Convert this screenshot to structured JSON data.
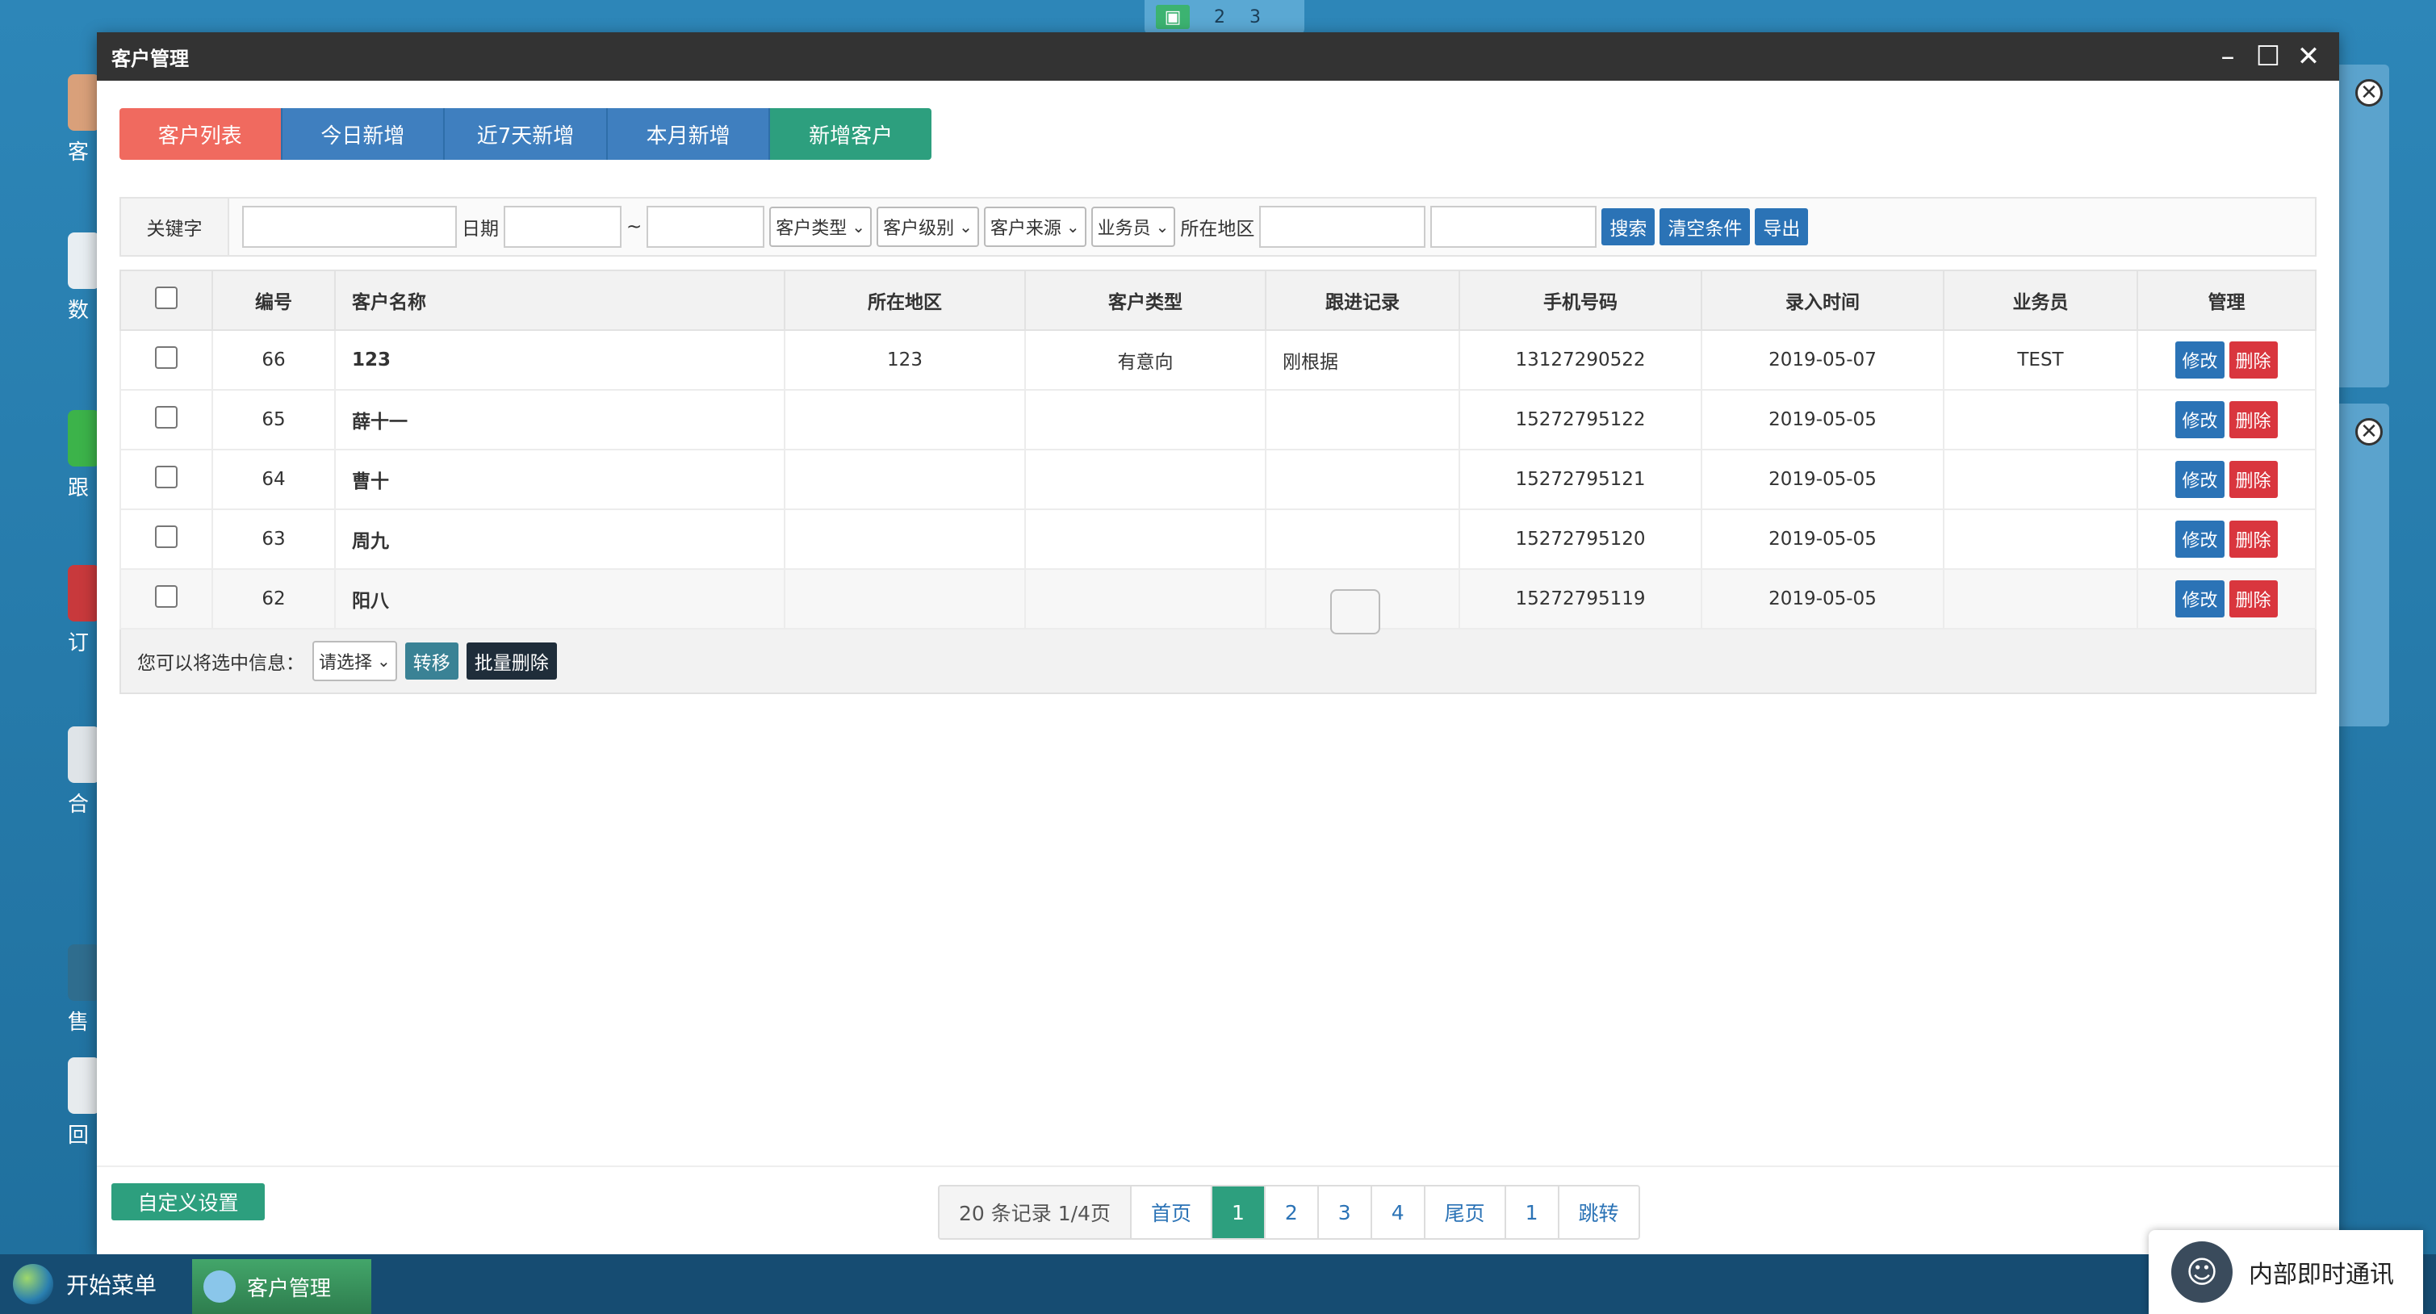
{
  "workspace": {
    "items": [
      "2",
      "3"
    ]
  },
  "desktop": {
    "icons": [
      "客",
      "数",
      "跟",
      "订",
      "合",
      "售",
      "回"
    ]
  },
  "window": {
    "title": "客户管理"
  },
  "tabs": [
    "客户列表",
    "今日新增",
    "近7天新增",
    "本月新增",
    "新增客户"
  ],
  "search": {
    "keyword_label": "关键字",
    "date_label": "日期",
    "tilde": "~",
    "selects": [
      "客户类型",
      "客户级别",
      "客户来源",
      "业务员"
    ],
    "region_label": "所在地区",
    "buttons": [
      "搜索",
      "清空条件",
      "导出"
    ]
  },
  "table": {
    "headers": [
      "编号",
      "客户名称",
      "所在地区",
      "客户类型",
      "跟进记录",
      "手机号码",
      "录入时间",
      "业务员",
      "管理"
    ],
    "rows": [
      {
        "id": "66",
        "name": "123",
        "region": "123",
        "type": "有意向",
        "follow": "刚根据",
        "phone": "13127290522",
        "date": "2019-05-07",
        "sales": "TEST"
      },
      {
        "id": "65",
        "name": "薛十一",
        "region": "",
        "type": "",
        "follow": "",
        "phone": "15272795122",
        "date": "2019-05-05",
        "sales": ""
      },
      {
        "id": "64",
        "name": "曹十",
        "region": "",
        "type": "",
        "follow": "",
        "phone": "15272795121",
        "date": "2019-05-05",
        "sales": ""
      },
      {
        "id": "63",
        "name": "周九",
        "region": "",
        "type": "",
        "follow": "",
        "phone": "15272795120",
        "date": "2019-05-05",
        "sales": ""
      },
      {
        "id": "62",
        "name": "阳八",
        "region": "",
        "type": "",
        "follow": "",
        "phone": "15272795119",
        "date": "2019-05-05",
        "sales": ""
      }
    ],
    "edit_label": "修改",
    "delete_label": "删除"
  },
  "batch": {
    "label": "您可以将选中信息：",
    "select": "请选择",
    "transfer": "转移",
    "bulk_delete": "批量删除"
  },
  "footer": {
    "custom_settings": "自定义设置",
    "pager_info": "20 条记录 1/4页",
    "first": "首页",
    "pages": [
      "1",
      "2",
      "3",
      "4"
    ],
    "current_page": "1",
    "last": "尾页",
    "jump_value": "1",
    "jump": "跳转"
  },
  "taskbar": {
    "start": "开始菜单",
    "task": "客户管理"
  },
  "im": {
    "label": "内部即时通讯"
  },
  "colors": {
    "accent_red": "#f06a5f",
    "tab_blue": "#3f7fbf",
    "green": "#2d9f7e",
    "danger": "#d9363e"
  }
}
